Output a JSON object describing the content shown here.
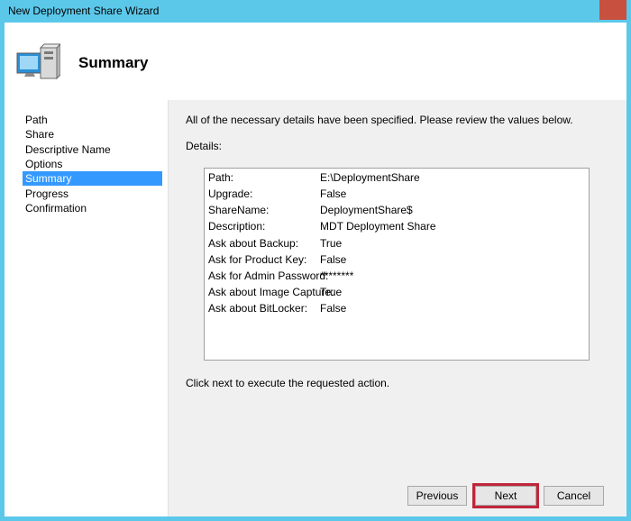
{
  "window": {
    "title": "New Deployment Share Wizard"
  },
  "header": {
    "title": "Summary",
    "icon": "computer-icon"
  },
  "sidebar": {
    "items": [
      {
        "label": "Path"
      },
      {
        "label": "Share"
      },
      {
        "label": "Descriptive Name"
      },
      {
        "label": "Options"
      },
      {
        "label": "Summary",
        "selected": true
      },
      {
        "label": "Progress"
      },
      {
        "label": "Confirmation"
      }
    ]
  },
  "main": {
    "intro": "All of the necessary details have been specified.  Please review the values below.",
    "details_label": "Details:",
    "details": [
      {
        "key": "Path:",
        "value": "E:\\DeploymentShare"
      },
      {
        "key": "Upgrade:",
        "value": "False"
      },
      {
        "key": "ShareName:",
        "value": "DeploymentShare$"
      },
      {
        "key": "Description:",
        "value": "MDT Deployment Share"
      },
      {
        "key": "Ask about Backup:",
        "value": "True"
      },
      {
        "key": "Ask for Product Key:",
        "value": "False"
      },
      {
        "key": "Ask for Admin Password:",
        "value": "********"
      },
      {
        "key": "Ask about Image Capture:",
        "value": "True"
      },
      {
        "key": "Ask about BitLocker:",
        "value": "False"
      }
    ],
    "footer_text": "Click next to execute the requested action."
  },
  "buttons": {
    "previous": "Previous",
    "next": "Next",
    "cancel": "Cancel"
  },
  "colors": {
    "titlebar": "#5bc8ea",
    "close_button": "#c7503f",
    "selection": "#3399ff",
    "highlight": "#c0263a"
  }
}
